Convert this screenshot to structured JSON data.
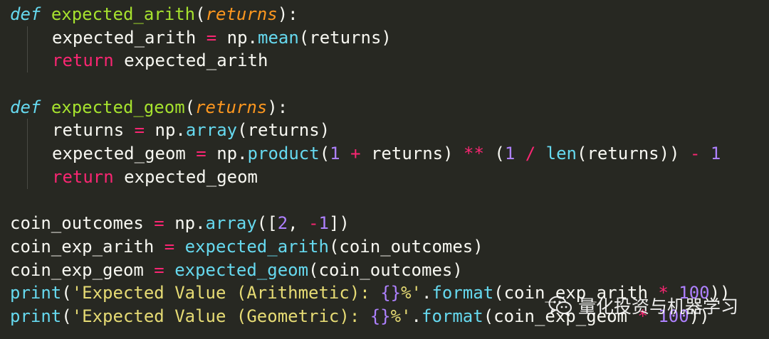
{
  "code": {
    "lines": [
      [
        [
          "kw-def",
          "def"
        ],
        [
          "plain",
          " "
        ],
        [
          "fn-name",
          "expected_arith"
        ],
        [
          "plain",
          "("
        ],
        [
          "param",
          "returns"
        ],
        [
          "plain",
          "):"
        ]
      ],
      [
        [
          "plain",
          "expected_arith "
        ],
        [
          "op",
          "="
        ],
        [
          "plain",
          " np."
        ],
        [
          "builtin",
          "mean"
        ],
        [
          "plain",
          "(returns)"
        ]
      ],
      [
        [
          "kw",
          "return"
        ],
        [
          "plain",
          " expected_arith"
        ]
      ],
      [],
      [
        [
          "kw-def",
          "def"
        ],
        [
          "plain",
          " "
        ],
        [
          "fn-name",
          "expected_geom"
        ],
        [
          "plain",
          "("
        ],
        [
          "param",
          "returns"
        ],
        [
          "plain",
          "):"
        ]
      ],
      [
        [
          "plain",
          "returns "
        ],
        [
          "op",
          "="
        ],
        [
          "plain",
          " np."
        ],
        [
          "builtin",
          "array"
        ],
        [
          "plain",
          "(returns)"
        ]
      ],
      [
        [
          "plain",
          "expected_geom "
        ],
        [
          "op",
          "="
        ],
        [
          "plain",
          " np."
        ],
        [
          "builtin",
          "product"
        ],
        [
          "plain",
          "("
        ],
        [
          "num",
          "1"
        ],
        [
          "plain",
          " "
        ],
        [
          "op",
          "+"
        ],
        [
          "plain",
          " returns) "
        ],
        [
          "op",
          "**"
        ],
        [
          "plain",
          " ("
        ],
        [
          "num",
          "1"
        ],
        [
          "plain",
          " "
        ],
        [
          "op",
          "/"
        ],
        [
          "plain",
          " "
        ],
        [
          "builtin",
          "len"
        ],
        [
          "plain",
          "(returns)) "
        ],
        [
          "op",
          "-"
        ],
        [
          "plain",
          " "
        ],
        [
          "num",
          "1"
        ]
      ],
      [
        [
          "kw",
          "return"
        ],
        [
          "plain",
          " expected_geom"
        ]
      ],
      [],
      [
        [
          "plain",
          "coin_outcomes "
        ],
        [
          "op",
          "="
        ],
        [
          "plain",
          " np."
        ],
        [
          "builtin",
          "array"
        ],
        [
          "plain",
          "(["
        ],
        [
          "num",
          "2"
        ],
        [
          "plain",
          ", "
        ],
        [
          "op",
          "-"
        ],
        [
          "num",
          "1"
        ],
        [
          "plain",
          "])"
        ]
      ],
      [
        [
          "plain",
          "coin_exp_arith "
        ],
        [
          "op",
          "="
        ],
        [
          "plain",
          " "
        ],
        [
          "builtin",
          "expected_arith"
        ],
        [
          "plain",
          "(coin_outcomes)"
        ]
      ],
      [
        [
          "plain",
          "coin_exp_geom "
        ],
        [
          "op",
          "="
        ],
        [
          "plain",
          " "
        ],
        [
          "builtin",
          "expected_geom"
        ],
        [
          "plain",
          "(coin_outcomes)"
        ]
      ],
      [
        [
          "builtin",
          "print"
        ],
        [
          "plain",
          "("
        ],
        [
          "str",
          "'Expected Value (Arithmetic): "
        ],
        [
          "num",
          "{}"
        ],
        [
          "str",
          "%'"
        ],
        [
          "plain",
          "."
        ],
        [
          "builtin",
          "format"
        ],
        [
          "plain",
          "(coin_exp_arith "
        ],
        [
          "op",
          "*"
        ],
        [
          "plain",
          " "
        ],
        [
          "num",
          "100"
        ],
        [
          "plain",
          "))"
        ]
      ],
      [
        [
          "builtin",
          "print"
        ],
        [
          "plain",
          "("
        ],
        [
          "str",
          "'Expected Value (Geometric): "
        ],
        [
          "num",
          "{}"
        ],
        [
          "str",
          "%'"
        ],
        [
          "plain",
          "."
        ],
        [
          "builtin",
          "format"
        ],
        [
          "plain",
          "(coin_exp_geom "
        ],
        [
          "op",
          "*"
        ],
        [
          "plain",
          " "
        ],
        [
          "num",
          "100"
        ],
        [
          "plain",
          "))"
        ]
      ]
    ],
    "indented_lines": [
      1,
      2,
      5,
      6,
      7
    ]
  },
  "watermark": {
    "text": "量化投资与机器学习",
    "icon": "wechat-icon"
  }
}
